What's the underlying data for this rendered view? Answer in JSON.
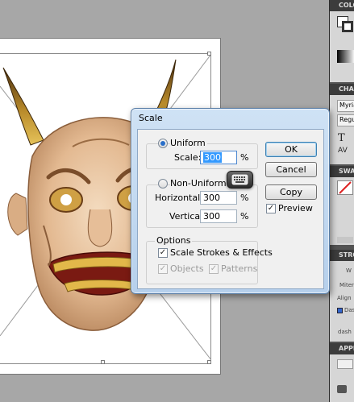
{
  "dialog": {
    "title": "Scale",
    "uniform": {
      "label": "Uniform",
      "selected": true,
      "scale_label": "Scale:",
      "scale_value": "300",
      "unit": "%"
    },
    "non_uniform": {
      "label": "Non-Uniform",
      "selected": false,
      "horizontal_label": "Horizontal:",
      "horizontal_value": "300",
      "horizontal_unit": "%",
      "vertical_label": "Vertical:",
      "vertical_value": "300",
      "vertical_unit": "%"
    },
    "options": {
      "title": "Options",
      "scale_strokes": {
        "label": "Scale Strokes & Effects",
        "checked": true
      },
      "objects": {
        "label": "Objects",
        "checked": true,
        "enabled": false
      },
      "patterns": {
        "label": "Patterns",
        "checked": true,
        "enabled": false
      }
    },
    "buttons": {
      "ok": "OK",
      "cancel": "Cancel",
      "copy": "Copy"
    },
    "preview": {
      "label": "Preview",
      "checked": true
    }
  },
  "dock": {
    "color_header": "COLO",
    "character_header": "CHA",
    "font_family": "Myria",
    "font_style": "Regu",
    "swatches_header": "SWA",
    "stroke_header": "STRO",
    "stroke_weight_label": "W",
    "miter_label": "Miter",
    "align_label": "Align",
    "dashed_label": "Das",
    "dash_label": "dash",
    "appearance_header": "APPE"
  },
  "colors": {
    "dialog_frame": "#b6d0ec",
    "selection": "#3399ff",
    "panel_bg": "#535353"
  }
}
